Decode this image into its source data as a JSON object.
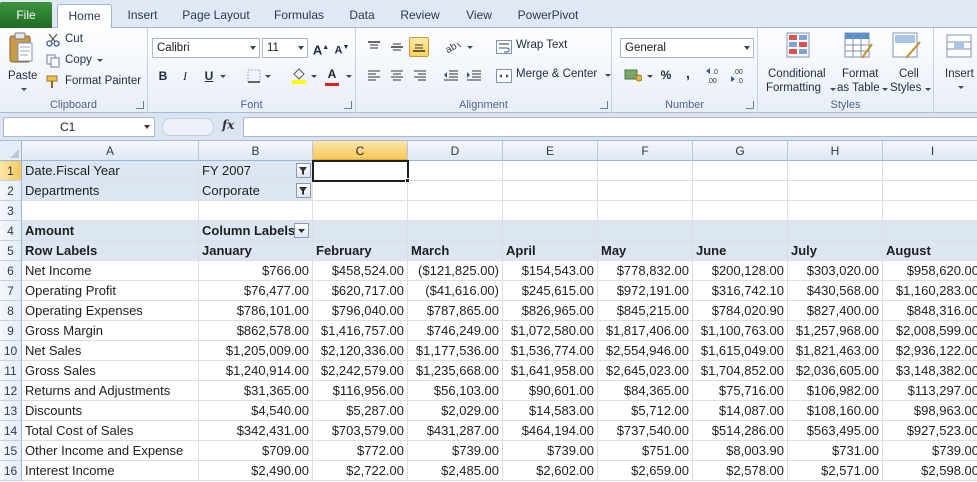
{
  "tabs": {
    "file": "File",
    "items": [
      "Home",
      "Insert",
      "Page Layout",
      "Formulas",
      "Data",
      "Review",
      "View",
      "PowerPivot"
    ],
    "active": "Home"
  },
  "ribbon": {
    "clipboard": {
      "label": "Clipboard",
      "paste": "Paste",
      "cut": "Cut",
      "copy": "Copy",
      "format_painter": "Format Painter"
    },
    "font": {
      "label": "Font",
      "font_name": "Calibri",
      "font_size": "11",
      "bold": "B",
      "italic": "I",
      "underline": "U",
      "grow": "A",
      "shrink": "A"
    },
    "alignment": {
      "label": "Alignment",
      "wrap_text": "Wrap Text",
      "merge_center": "Merge & Center"
    },
    "number": {
      "label": "Number",
      "format": "General",
      "percent": "%",
      "comma": ",",
      "inc_decimal": ".00",
      "dec_decimal": ".00"
    },
    "styles": {
      "label": "Styles",
      "conditional": "Conditional",
      "conditional2": "Formatting",
      "format_as": "Format",
      "format_as2": "as Table",
      "cell_styles": "Cell",
      "cell_styles2": "Styles"
    },
    "cells": {
      "insert": "Insert"
    }
  },
  "formula_bar": {
    "name_box": "C1",
    "fx": "fx",
    "formula": ""
  },
  "grid": {
    "columns": [
      "A",
      "B",
      "C",
      "D",
      "E",
      "F",
      "G",
      "H",
      "I"
    ],
    "rows": [
      "1",
      "2",
      "3",
      "4",
      "5",
      "6",
      "7",
      "8",
      "9",
      "10",
      "11",
      "12",
      "13",
      "14",
      "15",
      "16"
    ],
    "selected_column": "C",
    "selected_row": "1",
    "filters": [
      {
        "label": "Date.Fiscal Year",
        "value": "FY 2007"
      },
      {
        "label": "Departments",
        "value": "Corporate"
      }
    ],
    "values_label": "Amount",
    "column_labels": "Column Labels",
    "row_labels": "Row Labels",
    "months": [
      "January",
      "February",
      "March",
      "April",
      "May",
      "June",
      "July",
      "August"
    ],
    "data": [
      {
        "label": "Net Income",
        "values": [
          "$766.00",
          "$458,524.00",
          "($121,825.00)",
          "$154,543.00",
          "$778,832.00",
          "$200,128.00",
          "$303,020.00",
          "$958,620.00"
        ]
      },
      {
        "label": "Operating Profit",
        "values": [
          "$76,477.00",
          "$620,717.00",
          "($41,616.00)",
          "$245,615.00",
          "$972,191.00",
          "$316,742.10",
          "$430,568.00",
          "$1,160,283.00"
        ]
      },
      {
        "label": "Operating Expenses",
        "values": [
          "$786,101.00",
          "$796,040.00",
          "$787,865.00",
          "$826,965.00",
          "$845,215.00",
          "$784,020.90",
          "$827,400.00",
          "$848,316.00"
        ]
      },
      {
        "label": "Gross Margin",
        "values": [
          "$862,578.00",
          "$1,416,757.00",
          "$746,249.00",
          "$1,072,580.00",
          "$1,817,406.00",
          "$1,100,763.00",
          "$1,257,968.00",
          "$2,008,599.00"
        ]
      },
      {
        "label": "Net Sales",
        "values": [
          "$1,205,009.00",
          "$2,120,336.00",
          "$1,177,536.00",
          "$1,536,774.00",
          "$2,554,946.00",
          "$1,615,049.00",
          "$1,821,463.00",
          "$2,936,122.00"
        ]
      },
      {
        "label": "Gross Sales",
        "values": [
          "$1,240,914.00",
          "$2,242,579.00",
          "$1,235,668.00",
          "$1,641,958.00",
          "$2,645,023.00",
          "$1,704,852.00",
          "$2,036,605.00",
          "$3,148,382.00"
        ]
      },
      {
        "label": "Returns and Adjustments",
        "values": [
          "$31,365.00",
          "$116,956.00",
          "$56,103.00",
          "$90,601.00",
          "$84,365.00",
          "$75,716.00",
          "$106,982.00",
          "$113,297.00"
        ]
      },
      {
        "label": "Discounts",
        "values": [
          "$4,540.00",
          "$5,287.00",
          "$2,029.00",
          "$14,583.00",
          "$5,712.00",
          "$14,087.00",
          "$108,160.00",
          "$98,963.00"
        ]
      },
      {
        "label": "Total Cost of Sales",
        "values": [
          "$342,431.00",
          "$703,579.00",
          "$431,287.00",
          "$464,194.00",
          "$737,540.00",
          "$514,286.00",
          "$563,495.00",
          "$927,523.00"
        ]
      },
      {
        "label": "Other Income and Expense",
        "values": [
          "$709.00",
          "$772.00",
          "$739.00",
          "$739.00",
          "$751.00",
          "$8,003.90",
          "$731.00",
          "$739.00"
        ]
      },
      {
        "label": "Interest Income",
        "values": [
          "$2,490.00",
          "$2,722.00",
          "$2,485.00",
          "$2,602.00",
          "$2,659.00",
          "$2,578.00",
          "$2,571.00",
          "$2,598.00"
        ]
      }
    ]
  },
  "colors": {
    "file_tab": "#2e7d32",
    "selection_header": "#f6c85a",
    "pivot_header_fill": "#dce6f2",
    "ribbon_bg": "#e8eef7"
  }
}
